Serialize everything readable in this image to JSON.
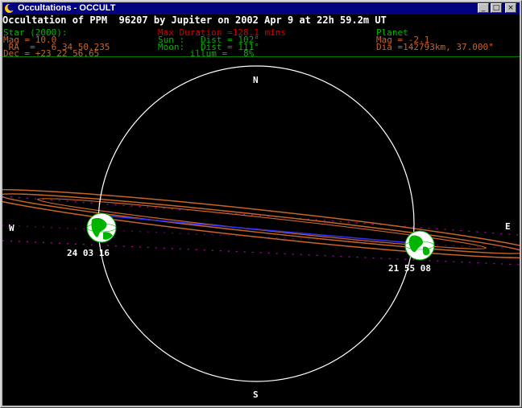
{
  "window": {
    "title": "Occultations - OCCULT",
    "buttons": {
      "minimize": "_",
      "maximize": "□",
      "close": "×"
    }
  },
  "header": {
    "line": "Occultation of PPM  96207 by Jupiter on 2002 Apr 9 at 22h 59.2m UT"
  },
  "star": {
    "heading": "Star (2000):",
    "mag": "Mag = 10.0",
    "ra": " RA  =   6 34 50.235",
    "dec": "Dec = +23 22 56.65"
  },
  "circumstances": {
    "max_duration": "Max Duration =128.1 mins",
    "sun": "Sun :   Dist = 102°",
    "moon": "Moon:   Dist = 111°",
    "illum": "      illum =   8%"
  },
  "planet": {
    "heading": "Planet",
    "mag": "Mag = -2.1",
    "dia": "Dia =142793km, 37.000\""
  },
  "plot": {
    "compass": {
      "north": "N",
      "south": "S",
      "west": "W",
      "east": "E"
    },
    "event_times": {
      "disappearance": "24 03 16",
      "reappearance": "21 55 08"
    },
    "colors": {
      "planet_limb": "#ffffff",
      "ring": "#c86428",
      "track": "#3030ff",
      "dotted_limits": "#b000b0",
      "earth_land": "#00b400",
      "earth_ocean": "#ffffff"
    }
  }
}
